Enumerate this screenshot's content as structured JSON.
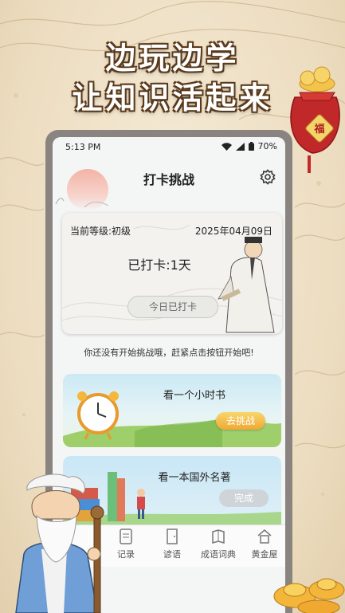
{
  "promo": {
    "line1": "边玩边学",
    "line2": "让知识活起来"
  },
  "status_bar": {
    "time": "5:13 PM",
    "battery": "70%"
  },
  "header": {
    "title": "打卡挑战"
  },
  "checkin_card": {
    "level": "当前等级:初级",
    "date": "2025年04月09日",
    "checked_days": "已打卡:1天",
    "button": "今日已打卡"
  },
  "hint": "你还没有开始挑战哦，赶紧点击按钮开始吧!",
  "tasks": [
    {
      "name": "看一个小时书",
      "button": "去挑战"
    },
    {
      "name": "看一本国外名著",
      "button": "完成"
    }
  ],
  "tabs": [
    {
      "label": "记录",
      "icon": "document-icon"
    },
    {
      "label": "谚语",
      "icon": "door-icon"
    },
    {
      "label": "成语词典",
      "icon": "dictionary-icon"
    },
    {
      "label": "黄金屋",
      "icon": "house-icon"
    }
  ],
  "colors": {
    "accent": "#f0a936",
    "card_bg": "#f3f2ee",
    "screen_bg": "#f4f5f5",
    "poster_bg": "#efe3cc"
  }
}
